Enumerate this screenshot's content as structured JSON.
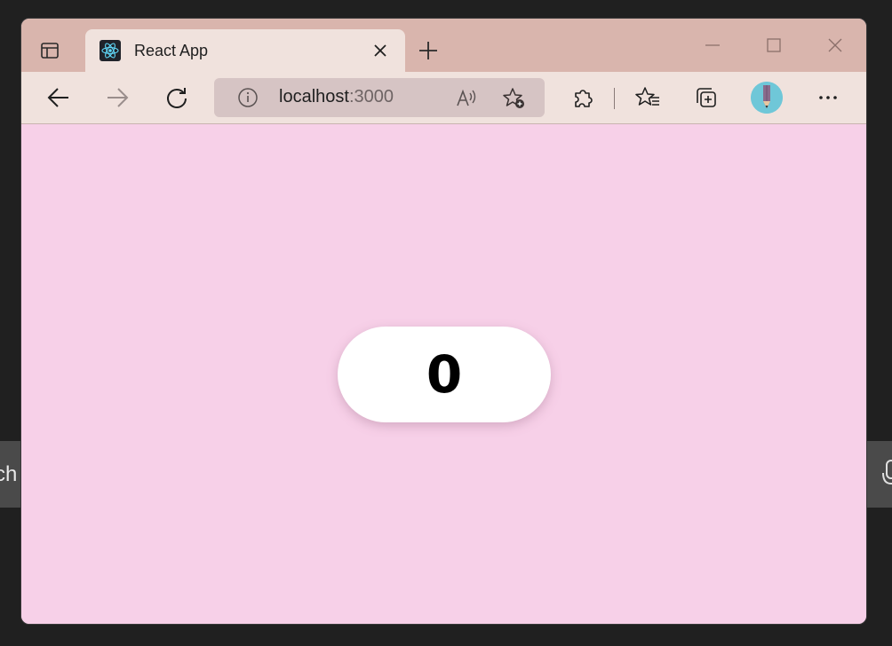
{
  "desktop": {
    "search_fragment": "ch"
  },
  "browser": {
    "tab": {
      "title": "React App",
      "favicon": "react-logo-icon"
    },
    "address": {
      "host": "localhost",
      "port": ":3000"
    },
    "icons": {
      "tab_actions": "tab-actions-icon",
      "close_tab": "close-icon",
      "new_tab": "plus-icon",
      "minimize": "minimize-icon",
      "maximize": "maximize-icon",
      "close_window": "close-icon",
      "back": "back-arrow-icon",
      "forward": "forward-arrow-icon",
      "refresh": "refresh-icon",
      "site_info": "info-icon",
      "read_aloud": "read-aloud-icon",
      "add_favorite": "star-plus-icon",
      "extensions": "puzzle-icon",
      "favorites": "favorites-list-icon",
      "collections": "collections-icon",
      "profile": "avatar",
      "more": "ellipsis-icon"
    },
    "colors": {
      "titlebar": "#d9b5ad",
      "toolbar": "#f0e2dd",
      "page_background": "#f7d0e8"
    }
  },
  "page": {
    "counter_value": "0"
  }
}
